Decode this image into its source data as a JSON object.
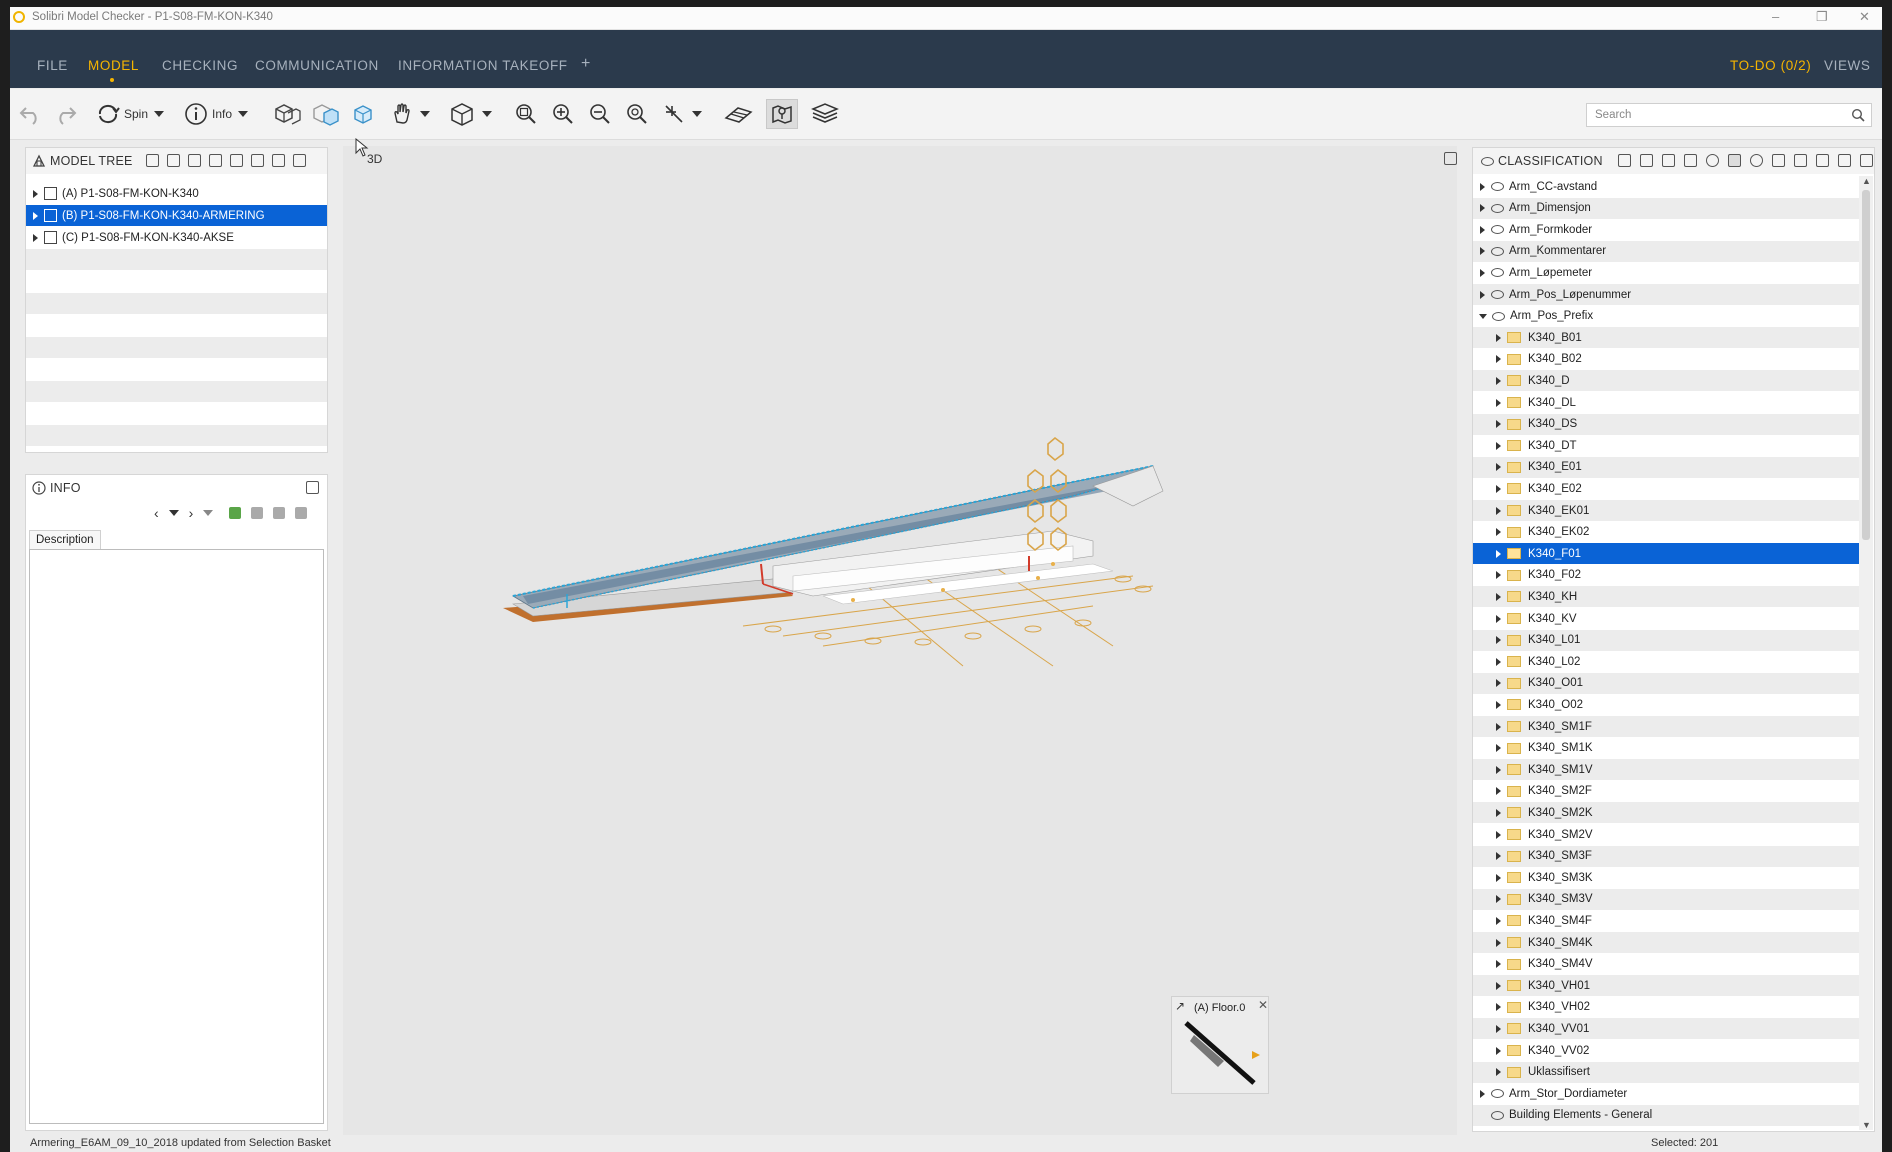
{
  "window": {
    "title": "Solibri Model Checker - P1-S08-FM-KON-K340",
    "controls": [
      "–",
      "❐",
      "✕"
    ]
  },
  "menubar": {
    "items": [
      "FILE",
      "MODEL",
      "CHECKING",
      "COMMUNICATION",
      "INFORMATION TAKEOFF",
      "+"
    ],
    "active": "MODEL",
    "todo": "TO-DO (0/2)",
    "views": "VIEWS",
    "accent_color": "#f5b400",
    "bg_color": "#2b3a4c"
  },
  "toolbar": {
    "spin_label": "Spin",
    "info_label": "Info",
    "search_placeholder": "Search"
  },
  "model_tree": {
    "title": "MODEL TREE",
    "items": [
      {
        "label": "(A) P1-S08-FM-KON-K340",
        "selected": false
      },
      {
        "label": "(B) P1-S08-FM-KON-K340-ARMERING",
        "selected": true
      },
      {
        "label": "(C) P1-S08-FM-KON-K340-AKSE",
        "selected": false
      }
    ]
  },
  "info_panel": {
    "title": "INFO",
    "tab": "Description"
  },
  "viewport": {
    "title": "3D",
    "navigator_label": "(A) Floor.0"
  },
  "classification": {
    "title": "CLASSIFICATION",
    "top_items": [
      "Arm_CC-avstand",
      "Arm_Dimensjon",
      "Arm_Formkoder",
      "Arm_Kommentarer",
      "Arm_Løpemeter",
      "Arm_Pos_Løpenummer"
    ],
    "expanded_item": "Arm_Pos_Prefix",
    "children": [
      "K340_B01",
      "K340_B02",
      "K340_D",
      "K340_DL",
      "K340_DS",
      "K340_DT",
      "K340_E01",
      "K340_E02",
      "K340_EK01",
      "K340_EK02",
      "K340_F01",
      "K340_F02",
      "K340_KH",
      "K340_KV",
      "K340_L01",
      "K340_L02",
      "K340_O01",
      "K340_O02",
      "K340_SM1F",
      "K340_SM1K",
      "K340_SM1V",
      "K340_SM2F",
      "K340_SM2K",
      "K340_SM2V",
      "K340_SM3F",
      "K340_SM3K",
      "K340_SM3V",
      "K340_SM4F",
      "K340_SM4K",
      "K340_SM4V",
      "K340_VH01",
      "K340_VH02",
      "K340_VV01",
      "K340_VV02",
      "Uklassifisert"
    ],
    "selected_child": "K340_F01",
    "bottom_items": [
      "Arm_Stor_Dordiameter",
      "Building Elements - General"
    ],
    "selection_color": "#0a63d6"
  },
  "status": {
    "left": "Armering_E6AM_09_10_2018 updated from Selection Basket",
    "right": "Selected: 201"
  }
}
